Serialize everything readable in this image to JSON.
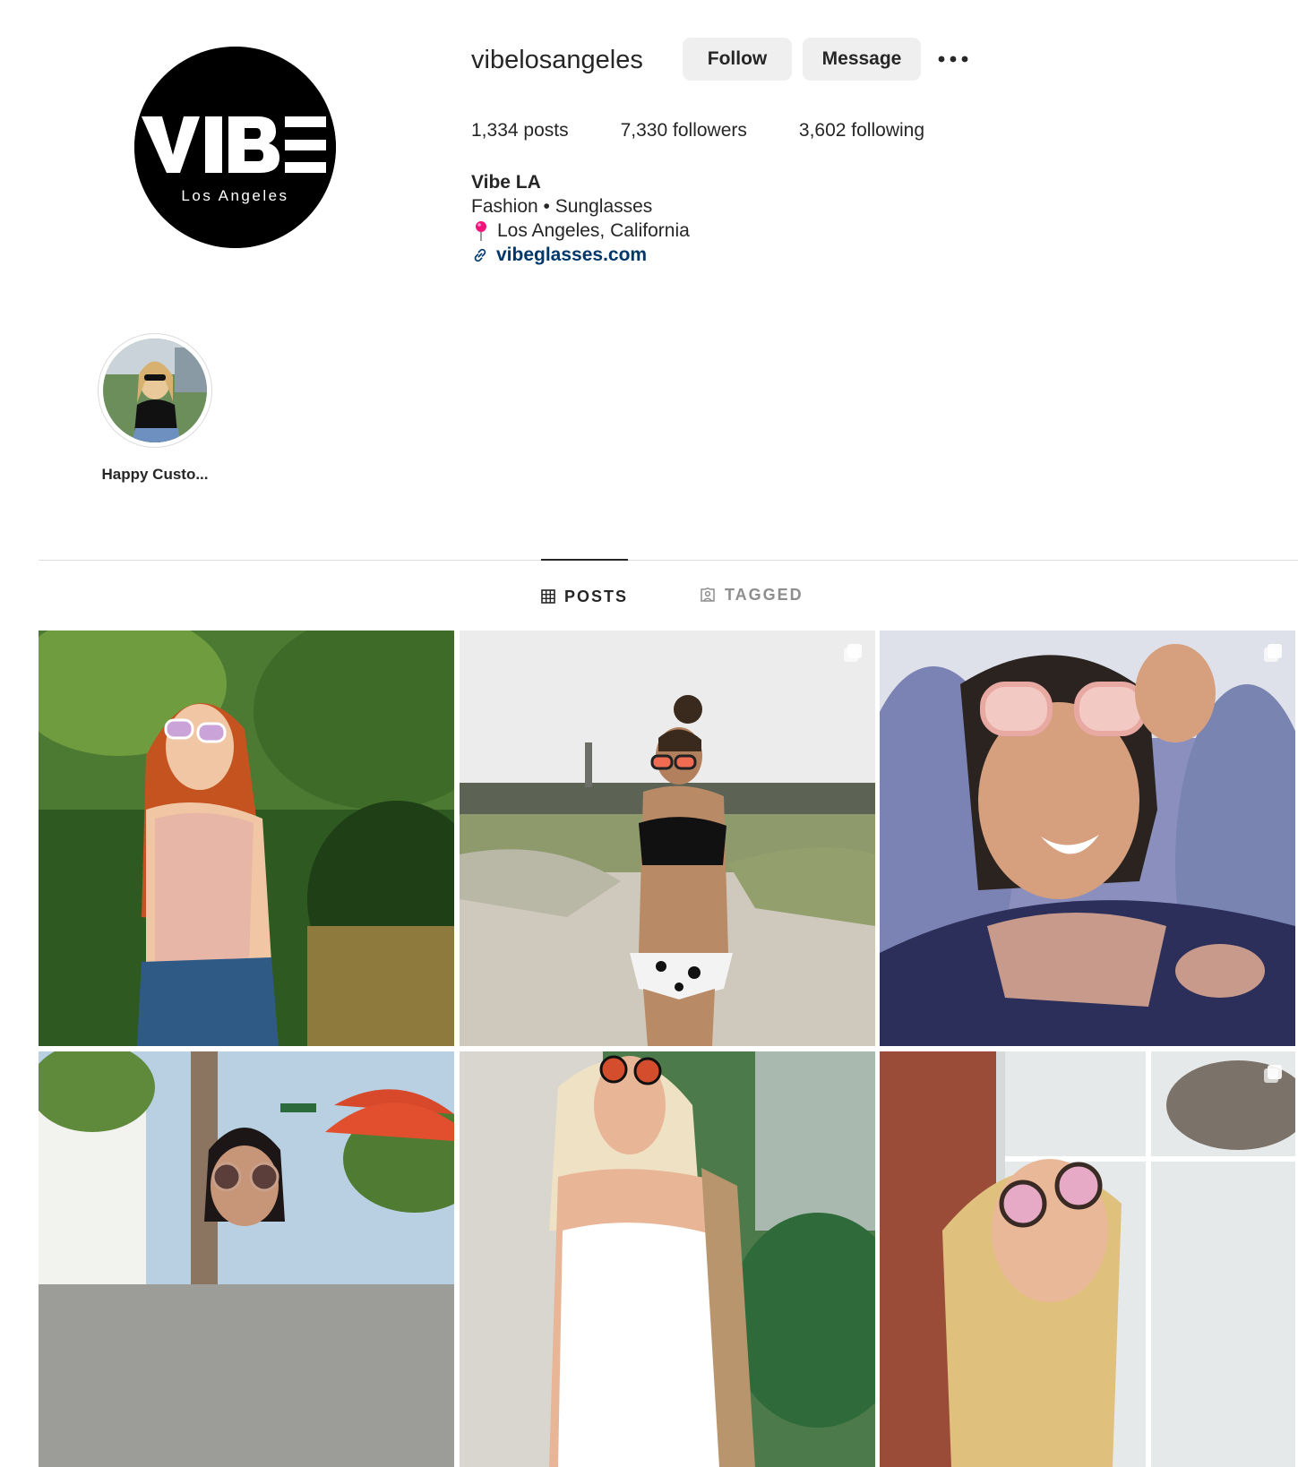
{
  "profile": {
    "username": "vibelosangeles",
    "avatar_logo_text": "VIBE",
    "avatar_logo_subtext": "Los Angeles",
    "follow_label": "Follow",
    "message_label": "Message",
    "more_icon": "more-options-icon"
  },
  "stats": {
    "posts": "1,334",
    "posts_label": "posts",
    "followers": "7,330",
    "followers_label": "followers",
    "following": "3,602",
    "following_label": "following"
  },
  "bio": {
    "name": "Vibe LA",
    "category": "Fashion • Sunglasses",
    "location": "Los Angeles, California",
    "website": "vibeglasses.com"
  },
  "highlights": [
    {
      "label": "Happy Custo..."
    }
  ],
  "tabs": [
    {
      "label": "POSTS",
      "icon": "grid-icon",
      "active": true
    },
    {
      "label": "TAGGED",
      "icon": "tagged-icon",
      "active": false
    }
  ],
  "posts": [
    {
      "desc": "red-hair-woman-garden",
      "multi": false
    },
    {
      "desc": "woman-beach-bikini",
      "multi": true
    },
    {
      "desc": "woman-pink-sunglasses-lavender",
      "multi": true
    },
    {
      "desc": "woman-street-umbrella",
      "multi": false
    },
    {
      "desc": "blonde-woman-tropical",
      "multi": false
    },
    {
      "desc": "blonde-woman-window",
      "multi": true
    }
  ],
  "colors": {
    "link": "#00376b",
    "button_bg": "#efefef",
    "divider": "#dbdbdb",
    "muted": "#8e8e8e"
  }
}
